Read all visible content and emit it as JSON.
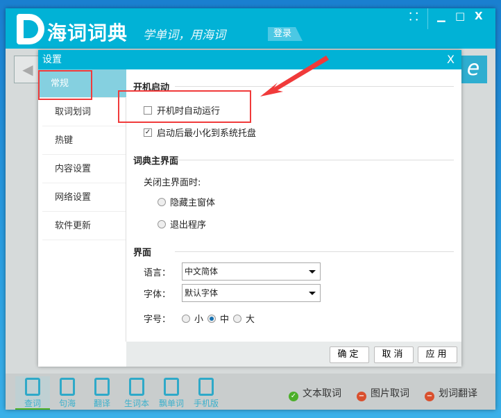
{
  "app": {
    "logo_text": "海词词典",
    "slogan": "学单词，用海词",
    "login": "登录",
    "ie_icon": "e"
  },
  "window_controls": {
    "skin": "⸬",
    "minimize": "▁",
    "maximize": "□",
    "close": "X"
  },
  "dialog": {
    "title": "设置",
    "close": "X",
    "sidebar": [
      {
        "label": "常规",
        "selected": true
      },
      {
        "label": "取词划词"
      },
      {
        "label": "热键"
      },
      {
        "label": "内容设置"
      },
      {
        "label": "网络设置"
      },
      {
        "label": "软件更新"
      }
    ],
    "startup": {
      "title": "开机启动",
      "auto_run": {
        "label": "开机时自动运行",
        "checked": false
      },
      "minimize_tray": {
        "label": "启动后最小化到系统托盘",
        "checked": true
      }
    },
    "main_ui": {
      "title": "词典主界面",
      "on_close_label": "关闭主界面时:",
      "options": [
        {
          "label": "隐藏主窗体",
          "selected": false
        },
        {
          "label": "退出程序",
          "selected": false
        }
      ]
    },
    "interface": {
      "title": "界面",
      "language_label": "语言：",
      "language_value": "中文简体",
      "font_label": "字体：",
      "font_value": "默认字体",
      "size_label": "字号：",
      "sizes": [
        {
          "label": "小",
          "selected": false
        },
        {
          "label": "中",
          "selected": true
        },
        {
          "label": "大",
          "selected": false
        }
      ]
    },
    "buttons": {
      "ok": "确定",
      "cancel": "取消",
      "apply": "应用"
    }
  },
  "toolbar": [
    {
      "label": "查词",
      "active": true
    },
    {
      "label": "句海"
    },
    {
      "label": "翻译"
    },
    {
      "label": "生词本"
    },
    {
      "label": "飘单词"
    },
    {
      "label": "手机版"
    }
  ],
  "status": [
    {
      "label": "文本取词",
      "state": "on",
      "color": "#4caf2a"
    },
    {
      "label": "图片取词",
      "state": "off",
      "color": "#d9502e"
    },
    {
      "label": "划词翻译",
      "state": "off",
      "color": "#d9502e"
    }
  ]
}
